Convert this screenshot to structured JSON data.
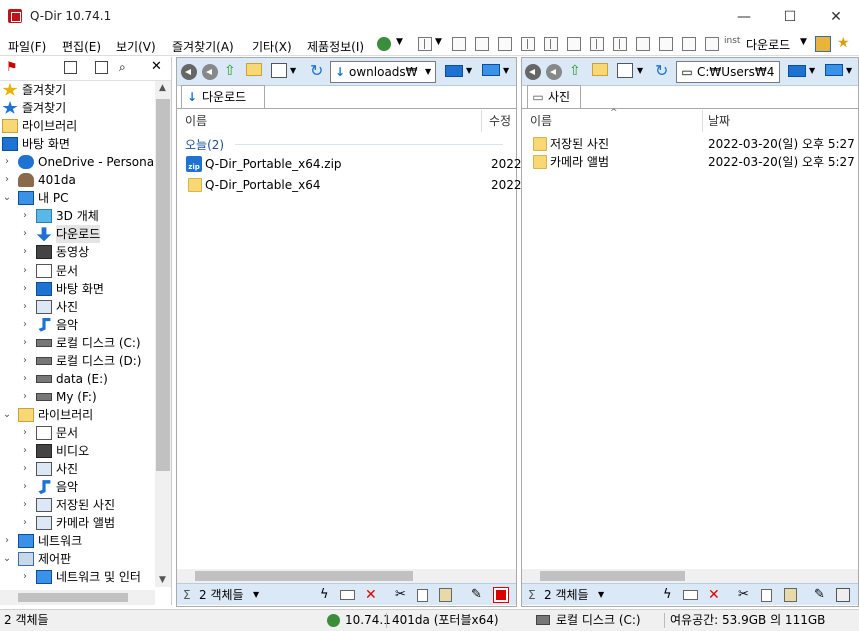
{
  "window": {
    "title": "Q-Dir 10.74.1",
    "min": "—",
    "max": "☐",
    "close": "✕"
  },
  "menu": [
    "파일(F)",
    "편집(E)",
    "보기(V)",
    "즐겨찾기(A)",
    "기타(X)",
    "제품정보(I)"
  ],
  "toolbar": {
    "downloads_label": "다운로드"
  },
  "tree": {
    "items": [
      {
        "label": "즐겨찾기",
        "icon": "star-icon",
        "indent": 0,
        "arrow": ""
      },
      {
        "label": "즐겨찾기",
        "icon": "star-blue-icon",
        "indent": 0,
        "arrow": ""
      },
      {
        "label": "라이브러리",
        "icon": "library-icon",
        "indent": 0,
        "arrow": ""
      },
      {
        "label": "바탕 화면",
        "icon": "desktop-icon",
        "indent": 0,
        "arrow": ""
      },
      {
        "label": "OneDrive - Personal",
        "icon": "cloud-icon",
        "indent": 1,
        "arrow": ">"
      },
      {
        "label": "401da",
        "icon": "user-icon",
        "indent": 1,
        "arrow": ">"
      },
      {
        "label": "내 PC",
        "icon": "pc-icon",
        "indent": 1,
        "arrow": "v"
      },
      {
        "label": "3D 개체",
        "icon": "cube-icon",
        "indent": 2,
        "arrow": ">"
      },
      {
        "label": "다운로드",
        "icon": "download-icon",
        "indent": 2,
        "arrow": ">",
        "selected": true
      },
      {
        "label": "동영상",
        "icon": "video-icon",
        "indent": 2,
        "arrow": ">"
      },
      {
        "label": "문서",
        "icon": "document-icon",
        "indent": 2,
        "arrow": ">"
      },
      {
        "label": "바탕 화면",
        "icon": "desktop-icon",
        "indent": 2,
        "arrow": ">"
      },
      {
        "label": "사진",
        "icon": "picture-icon",
        "indent": 2,
        "arrow": ">"
      },
      {
        "label": "음악",
        "icon": "music-icon",
        "indent": 2,
        "arrow": ">"
      },
      {
        "label": "로컬 디스크 (C:)",
        "icon": "drive-icon",
        "indent": 2,
        "arrow": ">"
      },
      {
        "label": "로컬 디스크 (D:)",
        "icon": "drive-icon",
        "indent": 2,
        "arrow": ">"
      },
      {
        "label": "data (E:)",
        "icon": "drive-icon",
        "indent": 2,
        "arrow": ">"
      },
      {
        "label": "My (F:)",
        "icon": "drive-icon",
        "indent": 2,
        "arrow": ">"
      },
      {
        "label": "라이브러리",
        "icon": "library-icon",
        "indent": 1,
        "arrow": "v"
      },
      {
        "label": "문서",
        "icon": "document-icon",
        "indent": 2,
        "arrow": ">"
      },
      {
        "label": "비디오",
        "icon": "video-icon",
        "indent": 2,
        "arrow": ">"
      },
      {
        "label": "사진",
        "icon": "picture-icon",
        "indent": 2,
        "arrow": ">"
      },
      {
        "label": "음악",
        "icon": "music-icon",
        "indent": 2,
        "arrow": ">"
      },
      {
        "label": "저장된 사진",
        "icon": "picture-icon",
        "indent": 2,
        "arrow": ">"
      },
      {
        "label": "카메라 앨범",
        "icon": "picture-icon",
        "indent": 2,
        "arrow": ">"
      },
      {
        "label": "네트워크",
        "icon": "network-icon",
        "indent": 1,
        "arrow": ">"
      },
      {
        "label": "제어판",
        "icon": "control-panel-icon",
        "indent": 1,
        "arrow": "v"
      },
      {
        "label": "네트워크 및 인터",
        "icon": "network-icon",
        "indent": 2,
        "arrow": ">"
      }
    ]
  },
  "left_pane": {
    "address": "ownloads₩",
    "tab": "다운로드",
    "col_name": "이름",
    "col_modified": "수정",
    "group": "오늘(2)",
    "files": [
      {
        "name": "Q-Dir_Portable_x64.zip",
        "date": "2022",
        "icon": "zip-icon"
      },
      {
        "name": "Q-Dir_Portable_x64",
        "date": "2022",
        "icon": "folder-icon"
      }
    ],
    "status": "2 객체들"
  },
  "right_pane": {
    "address": "C:₩Users₩4",
    "tab": "사진",
    "col_name": "이름",
    "col_date": "날짜",
    "files": [
      {
        "name": "저장된 사진",
        "date": "2022-03-20(일) 오후 5:27"
      },
      {
        "name": "카메라 앨범",
        "date": "2022-03-20(일) 오후 5:27"
      }
    ],
    "status": "2 객체들"
  },
  "bottom": {
    "left": "2 객체들",
    "version": "10.74.1",
    "user": "401da (포터블x64)",
    "drive": "로컬 디스크 (C:)",
    "free": "여유공간: 53.9GB 의 111GB"
  },
  "colors": {
    "toolbar_bg": "#dbe9f7",
    "accent": "#1e73d2"
  }
}
